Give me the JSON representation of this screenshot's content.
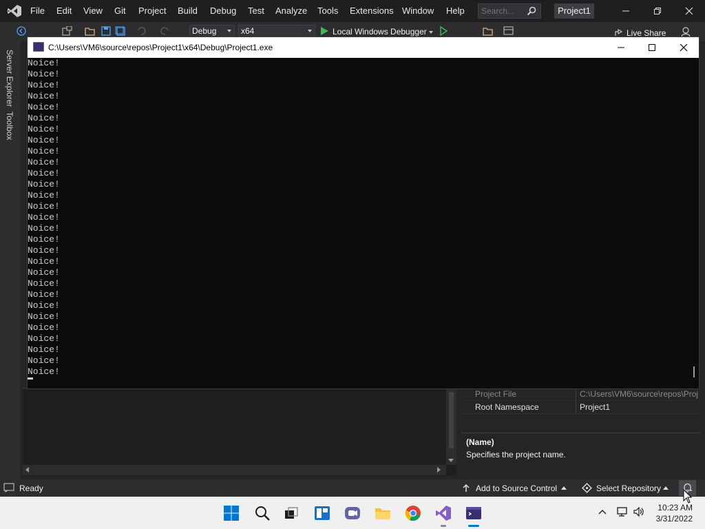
{
  "menubar": {
    "items": [
      "File",
      "Edit",
      "View",
      "Git",
      "Project",
      "Build",
      "Debug",
      "Test",
      "Analyze",
      "Tools",
      "Extensions",
      "Window",
      "Help"
    ],
    "search_placeholder": "Search...",
    "project_name": "Project1"
  },
  "toolbar": {
    "configuration": "Debug",
    "platform": "x64",
    "debugger_label": "Local Windows Debugger",
    "live_share": "Live Share"
  },
  "left_tabs": [
    "Server Explorer",
    "Toolbox"
  ],
  "console": {
    "title": "C:\\Users\\VM6\\source\\repos\\Project1\\x64\\Debug\\Project1.exe",
    "lines": [
      "Noice!",
      "Noice!",
      "Noice!",
      "Noice!",
      "Noice!",
      "Noice!",
      "Noice!",
      "Noice!",
      "Noice!",
      "Noice!",
      "Noice!",
      "Noice!",
      "Noice!",
      "Noice!",
      "Noice!",
      "Noice!",
      "Noice!",
      "Noice!",
      "Noice!",
      "Noice!",
      "Noice!",
      "Noice!",
      "Noice!",
      "Noice!",
      "Noice!",
      "Noice!",
      "Noice!",
      "Noice!",
      "Noice!"
    ]
  },
  "properties": {
    "rows": [
      {
        "key": "Project File",
        "value": "C:\\Users\\VM6\\source\\repos\\Proj"
      },
      {
        "key": "Root Namespace",
        "value": "Project1"
      }
    ],
    "description_title": "(Name)",
    "description_text": "Specifies the project name."
  },
  "statusbar": {
    "status": "Ready",
    "source_control": "Add to Source Control",
    "repository": "Select Repository"
  },
  "taskbar": {
    "time": "10:23 AM",
    "date": "3/31/2022"
  },
  "colors": {
    "vs_dark": "#1f1f1f",
    "toolbar": "#2d2d30",
    "console_bg": "#0c0c0c",
    "run_green": "#3fb950",
    "windows_blue": "#0078d4",
    "vs_purple": "#865fc5"
  }
}
